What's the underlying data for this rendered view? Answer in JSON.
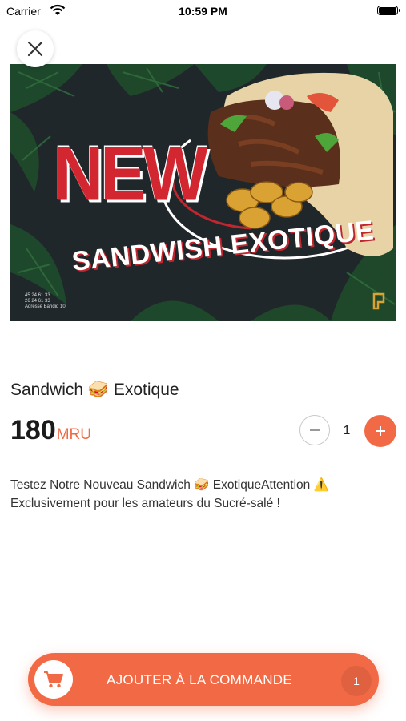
{
  "status_bar": {
    "carrier": "Carrier",
    "time": "10:59 PM"
  },
  "banner": {
    "badge": "NEW",
    "title": "SANDWISH EXOTIQUE",
    "contact_lines": [
      "45 24 61 33",
      "26 24 61 33",
      "Adresse Bahdid 10"
    ]
  },
  "product": {
    "name": "Sandwich 🥪 Exotique",
    "price": "180",
    "currency": "MRU",
    "quantity": "1",
    "description": "Testez Notre Nouveau Sandwich 🥪 ExotiqueAttention ⚠️ Exclusivement pour les amateurs du Sucré-salé !"
  },
  "cta": {
    "label": "AJOUTER À LA COMMANDE",
    "count": "1"
  },
  "colors": {
    "accent": "#f26a45",
    "banner_red": "#d22630",
    "banner_bg": "#1c2226"
  },
  "icons": [
    "wifi-icon",
    "battery-icon",
    "close-icon",
    "minus-icon",
    "plus-icon",
    "cart-icon"
  ]
}
